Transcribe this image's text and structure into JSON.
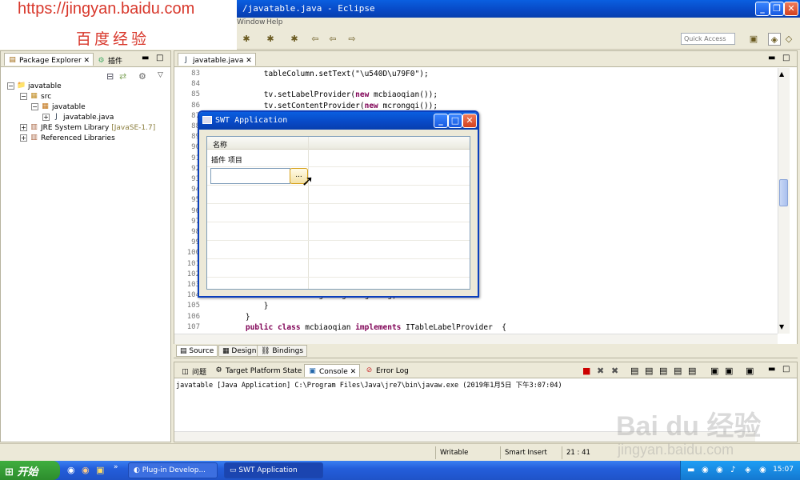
{
  "window": {
    "title": "/javatable.java - Eclipse"
  },
  "menu": {
    "items": [
      "Window",
      "Help"
    ]
  },
  "toolbar": {
    "quick_access_placeholder": "Quick Access"
  },
  "watermark": {
    "url": "https://jingyan.baidu.com",
    "brand": "百度经验",
    "corner_logo": "Bai du 经验",
    "corner_url": "jingyan.baidu.com"
  },
  "package_explorer": {
    "tabs": [
      "Package Explorer",
      "插件"
    ],
    "tree": [
      {
        "label": "javatable",
        "depth": 0,
        "icon": "project-icon"
      },
      {
        "label": "src",
        "depth": 1,
        "icon": "source-folder-icon"
      },
      {
        "label": "javatable",
        "depth": 2,
        "icon": "package-icon"
      },
      {
        "label": "javatable.java",
        "depth": 3,
        "icon": "java-file-icon"
      },
      {
        "label": "JRE System Library",
        "suffix": "[JavaSE-1.7]",
        "depth": 1,
        "icon": "library-icon"
      },
      {
        "label": "Referenced Libraries",
        "depth": 1,
        "icon": "library-icon"
      }
    ]
  },
  "editor": {
    "tab": "javatable.java",
    "lines": [
      {
        "n": "83",
        "code": "        tableColumn.setText(\"\\u540D\\u79F0\");"
      },
      {
        "n": "84",
        "code": ""
      },
      {
        "n": "85",
        "code": "        tv.setLabelProvider(new mcbiaoqian());"
      },
      {
        "n": "86",
        "code": "        tv.setContentProvider(new mcrongqi());"
      },
      {
        "n": "87",
        "code": ""
      },
      {
        "n": "88",
        "code": ""
      },
      {
        "n": "89",
        "code": ""
      },
      {
        "n": "90",
        "code": ""
      },
      {
        "n": "91",
        "code": ""
      },
      {
        "n": "92",
        "code": ""
      },
      {
        "n": "93",
        "code": ""
      },
      {
        "n": "94",
        "code": ""
      },
      {
        "n": "95",
        "code": "                                        R);"
      },
      {
        "n": "96",
        "code": ""
      },
      {
        "n": "97",
        "code": ""
      },
      {
        "n": "98",
        "code": ""
      },
      {
        "n": "99",
        "code": ""
      },
      {
        "n": "100",
        "code": ""
      },
      {
        "n": "101",
        "code": ""
      },
      {
        "n": "102",
        "code": ""
      },
      {
        "n": "103",
        "code": ""
      },
      {
        "n": "104",
        "code": "            this.mingcheng=mingcheng;"
      },
      {
        "n": "105",
        "code": "        }"
      },
      {
        "n": "106",
        "code": "    }"
      },
      {
        "n": "107",
        "code": "    public class mcbiaoqian implements ITableLabelProvider  {"
      }
    ],
    "bottom_tabs": [
      "Source",
      "Design",
      "Bindings"
    ]
  },
  "console": {
    "tabs": [
      "问题",
      "Target Platform State",
      "Console",
      "Error Log"
    ],
    "line": "javatable [Java Application] C:\\Program Files\\Java\\jre7\\bin\\javaw.exe (2019年1月5日 下午3:07:04)"
  },
  "statusbar": {
    "mode": "Writable",
    "insert": "Smart Insert",
    "position": "21 : 41"
  },
  "taskbar": {
    "start": "开始",
    "tasks": [
      "Plug-in Develop...",
      "SWT Application"
    ],
    "clock": "15:07"
  },
  "swt_dialog": {
    "title": "SWT Application",
    "column_header": "名称",
    "row1": "插件  项目",
    "edit_button": "..."
  }
}
